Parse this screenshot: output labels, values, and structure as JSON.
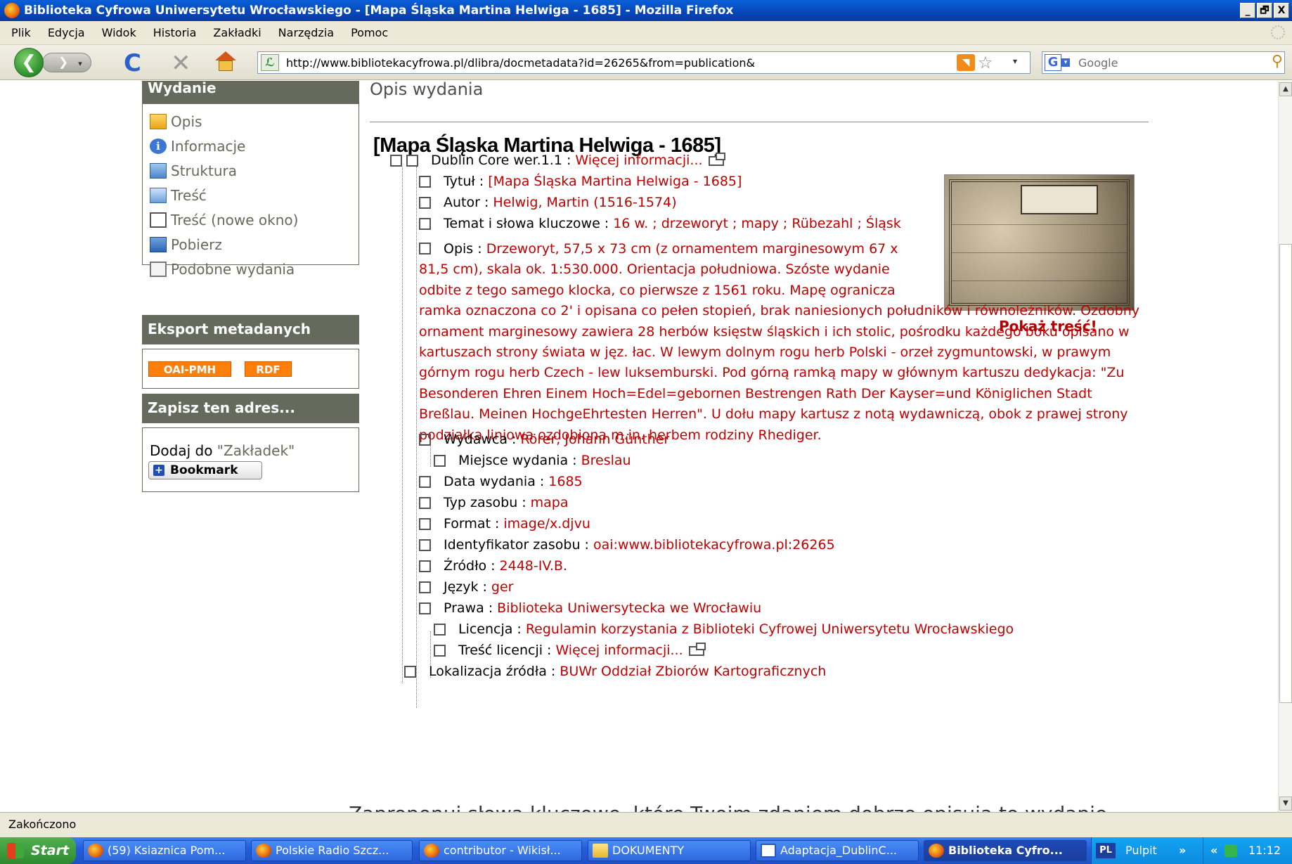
{
  "window": {
    "title": "Biblioteka Cyfrowa Uniwersytetu Wrocławskiego - [Mapa Śląska Martina Helwiga - 1685] - Mozilla Firefox",
    "controls": [
      "_",
      "🗗",
      "X"
    ]
  },
  "menu": [
    "Plik",
    "Edycja",
    "Widok",
    "Historia",
    "Zakładki",
    "Narzędzia",
    "Pomoc"
  ],
  "toolbar": {
    "back_glyph": "❮",
    "forward_glyph": "❯",
    "forward_caret": "▾",
    "reload_glyph": "C",
    "stop_glyph": "✕",
    "url": "http://www.bibliotekacyfrowa.pl/dlibra/docmetadata?id=26265&from=publication&",
    "url_drop_glyph": "▾",
    "star_glyph": "☆",
    "search_engine_letter": "G",
    "search_placeholder": "Google",
    "search_glyph": "⚲"
  },
  "sidebar": {
    "edition_header": "Wydanie",
    "edition_links": [
      {
        "label": "Opis",
        "icon": "page-icon"
      },
      {
        "label": "Informacje",
        "icon": "info-icon"
      },
      {
        "label": "Struktura",
        "icon": "structure-icon"
      },
      {
        "label": "Treść",
        "icon": "book-icon"
      },
      {
        "label": "Treść (nowe okno)",
        "icon": "new-window-icon"
      },
      {
        "label": "Pobierz",
        "icon": "save-disk-icon"
      },
      {
        "label": "Podobne wydania",
        "icon": "similar-docs-icon"
      }
    ],
    "export_header": "Eksport metadanych",
    "export_buttons": [
      "OAI-PMH",
      "RDF"
    ],
    "save_header": "Zapisz ten adres...",
    "bookmark_prefix": "Dodaj do ",
    "bookmark_quoted": "\"Zakładek\"",
    "bookmark_button": "Bookmark"
  },
  "main": {
    "section_heading": "Opis wydania",
    "doc_title": "[Mapa Śląska Martina Helwiga - 1685]",
    "show_content": "Pokaż treść!",
    "more_info": "Więcej informacji...",
    "metadata": {
      "dublin_core": "Dublin Core wer.1.1",
      "rows": [
        {
          "label": "Tytuł",
          "value": "[Mapa Śląska Martina Helwiga - 1685]"
        },
        {
          "label": "Autor",
          "value": "Helwig, Martin (1516-1574)"
        },
        {
          "label": "Temat i słowa kluczowe",
          "value": "16 w. ; drzeworyt ; mapy ; Rübezahl ; Śląsk"
        }
      ],
      "opis_label": "Opis",
      "opis_value": "Drzeworyt, 57,5 x 73 cm (z ornamentem marginesowym 67 x 81,5 cm), skala ok. 1:530.000. Orientacja południowa. Szóste wydanie odbite z tego samego klocka, co pierwsze z 1561 roku. Mapę ogranicza ramka oznaczona co 2' i opisana co pełen stopień, brak naniesionych południków i równoleżników. Ozdobny ornament marginesowy zawiera 28 herbów księstw śląskich i ich stolic, pośrodku każdego boku opisano w kartuszach strony świata w jęz. łac. W lewym dolnym rogu herb Polski - orzeł zygmuntowski, w prawym górnym rogu herb Czech - lew luksemburski. Pod górną ramką mapy w głównym kartuszu dedykacja: \"Zu Besonderen Ehren Einem Hoch=Edel=gebornen Bestrengen Rath Der Kayser=und Königlichen Stadt Breßlau. Meinen HochgeEhrtesten Herren\". U dołu mapy kartusz z notą wydawniczą, obok z prawej strony podziałka liniowa ozdobiona m.in. herbem rodziny Rhediger.",
      "wydawca": {
        "label": "Wydawca",
        "value": "Rörer, Johann Günther"
      },
      "miejsce": {
        "label": "Miejsce wydania",
        "value": "Breslau"
      },
      "rows2": [
        {
          "label": "Data wydania",
          "value": "1685"
        },
        {
          "label": "Typ zasobu",
          "value": "mapa"
        },
        {
          "label": "Format",
          "value": "image/x.djvu"
        },
        {
          "label": "Identyfikator zasobu",
          "value": "oai:www.bibliotekacyfrowa.pl:26265"
        },
        {
          "label": "Źródło",
          "value": "2448-IV.B."
        },
        {
          "label": "Język",
          "value": "ger"
        }
      ],
      "prawa": {
        "label": "Prawa",
        "value": "Biblioteka Uniwersytecka we Wrocławiu"
      },
      "licencja": {
        "label": "Licencja",
        "value": "Regulamin korzystania z Biblioteki Cyfrowej Uniwersytetu Wrocławskiego"
      },
      "tresc_licencji": {
        "label": "Treść licencji",
        "value": "Więcej informacji..."
      },
      "lokalizacja": {
        "label": "Lokalizacja źródła",
        "value": "BUWr Oddział Zbiorów Kartograficznych"
      }
    },
    "cutoff_text": "Zaproponuj słowa kluczowe, które Twoim zdaniem dobrze opisują to wydanie"
  },
  "scrollbar": {
    "up": "▲",
    "down": "▼"
  },
  "status": "Zakończono",
  "taskbar": {
    "start": "Start",
    "tasks": [
      {
        "label": "(59) Ksiaznica Pom...",
        "icon": "firefox-icon"
      },
      {
        "label": "Polskie Radio Szcz...",
        "icon": "firefox-icon"
      },
      {
        "label": "contributor - Wikisł...",
        "icon": "firefox-icon"
      },
      {
        "label": "DOKUMENTY",
        "icon": "folder-icon"
      },
      {
        "label": "Adaptacja_DublinC...",
        "icon": "word-icon"
      },
      {
        "label": "Biblioteka Cyfro...",
        "icon": "firefox-icon"
      }
    ],
    "lang": "PL",
    "desktop": "Pulpit",
    "chevron": "»",
    "double_arrow": "«",
    "clock": "11:12"
  }
}
